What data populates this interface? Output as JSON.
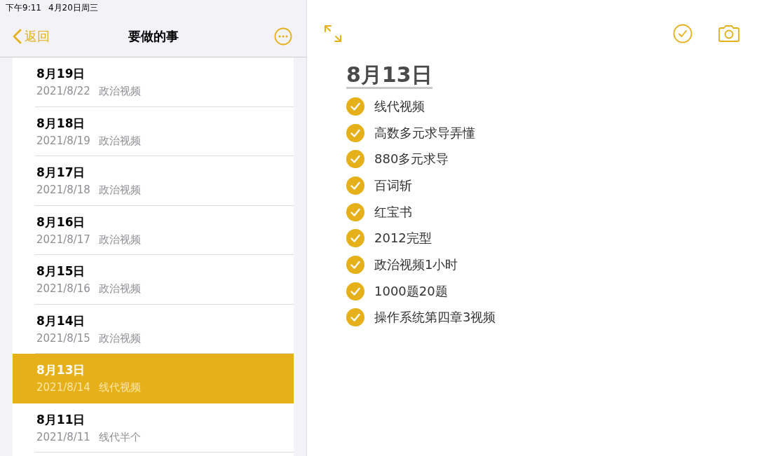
{
  "status_bar": {
    "time": "下午9:11",
    "date": "4月20日周三"
  },
  "nav": {
    "back": "返回",
    "title": "要做的事"
  },
  "notes": [
    {
      "title": "8月19日",
      "date": "2021/8/22",
      "preview": "政治视频",
      "selected": false
    },
    {
      "title": "8月18日",
      "date": "2021/8/19",
      "preview": "政治视频",
      "selected": false
    },
    {
      "title": "8月17日",
      "date": "2021/8/18",
      "preview": "政治视频",
      "selected": false
    },
    {
      "title": "8月16日",
      "date": "2021/8/17",
      "preview": "政治视频",
      "selected": false
    },
    {
      "title": "8月15日",
      "date": "2021/8/16",
      "preview": "政治视频",
      "selected": false
    },
    {
      "title": "8月14日",
      "date": "2021/8/15",
      "preview": "政治视频",
      "selected": false
    },
    {
      "title": "8月13日",
      "date": "2021/8/14",
      "preview": "线代视频",
      "selected": true
    },
    {
      "title": "8月11日",
      "date": "2021/8/11",
      "preview": "线代半个",
      "selected": false
    }
  ],
  "note": {
    "title": "8月13日",
    "checklist": [
      {
        "text": "线代视频",
        "checked": true
      },
      {
        "text": "高数多元求导弄懂",
        "checked": true
      },
      {
        "text": "880多元求导",
        "checked": true
      },
      {
        "text": "百词斩",
        "checked": true
      },
      {
        "text": "红宝书",
        "checked": true
      },
      {
        "text": "2012完型",
        "checked": true
      },
      {
        "text": "政治视频1小时",
        "checked": true
      },
      {
        "text": "1000题20题",
        "checked": true
      },
      {
        "text": "操作系统第四章3视频",
        "checked": true
      }
    ]
  }
}
